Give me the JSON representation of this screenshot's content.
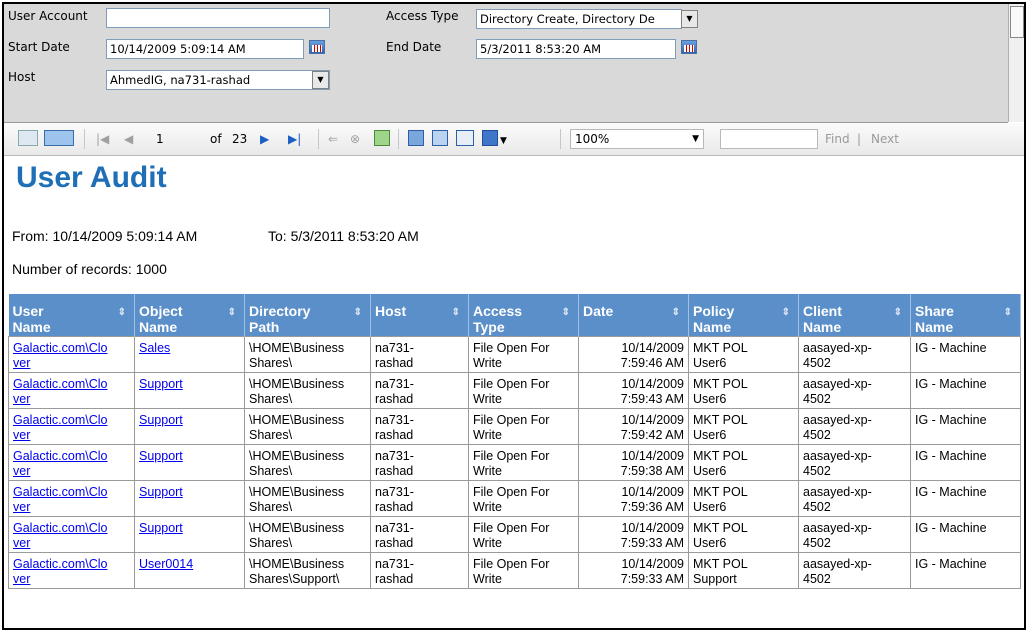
{
  "params": {
    "user_account_label": "User Account",
    "user_account_value": "",
    "access_type_label": "Access Type",
    "access_type_value": "Directory Create, Directory De",
    "start_date_label": "Start Date",
    "start_date_value": "10/14/2009 5:09:14 AM",
    "end_date_label": "End Date",
    "end_date_value": "5/3/2011 8:53:20 AM",
    "host_label": "Host",
    "host_value": "AhmedIG, na731-rashad"
  },
  "toolbar": {
    "page_current": "1",
    "page_of": "of",
    "page_total": "23",
    "zoom": "100%",
    "find_label": "Find",
    "find_sep": "|",
    "next_label": "Next"
  },
  "report": {
    "title": "User Audit",
    "from_text": "From: 10/14/2009 5:09:14 AM",
    "to_text": "To: 5/3/2011 8:53:20 AM",
    "records_text": "Number of records: 1000",
    "columns": [
      [
        "User",
        "Name"
      ],
      [
        "Object",
        "Name"
      ],
      [
        "Directory",
        "Path"
      ],
      [
        "Host",
        ""
      ],
      [
        "Access",
        "Type"
      ],
      [
        "Date",
        ""
      ],
      [
        "Policy",
        "Name"
      ],
      [
        "Client",
        "Name"
      ],
      [
        "Share",
        "Name"
      ]
    ],
    "sort_glyph": "⇕",
    "rows": [
      {
        "user": [
          "Galactic.com\\Clo",
          "ver"
        ],
        "object": "Sales",
        "path": [
          "\\HOME\\Business",
          "Shares\\"
        ],
        "host": [
          "na731-",
          "rashad"
        ],
        "access": [
          "File Open For",
          "Write"
        ],
        "date": [
          "10/14/2009",
          "7:59:46 AM"
        ],
        "policy": [
          "MKT POL",
          "User6"
        ],
        "client": [
          "aasayed-xp-",
          "4502"
        ],
        "share": "IG - Machine"
      },
      {
        "user": [
          "Galactic.com\\Clo",
          "ver"
        ],
        "object": "Support",
        "path": [
          "\\HOME\\Business",
          "Shares\\"
        ],
        "host": [
          "na731-",
          "rashad"
        ],
        "access": [
          "File Open For",
          "Write"
        ],
        "date": [
          "10/14/2009",
          "7:59:43 AM"
        ],
        "policy": [
          "MKT POL",
          "User6"
        ],
        "client": [
          "aasayed-xp-",
          "4502"
        ],
        "share": "IG - Machine"
      },
      {
        "user": [
          "Galactic.com\\Clo",
          "ver"
        ],
        "object": "Support",
        "path": [
          "\\HOME\\Business",
          "Shares\\"
        ],
        "host": [
          "na731-",
          "rashad"
        ],
        "access": [
          "File Open For",
          "Write"
        ],
        "date": [
          "10/14/2009",
          "7:59:42 AM"
        ],
        "policy": [
          "MKT POL",
          "User6"
        ],
        "client": [
          "aasayed-xp-",
          "4502"
        ],
        "share": "IG - Machine"
      },
      {
        "user": [
          "Galactic.com\\Clo",
          "ver"
        ],
        "object": "Support",
        "path": [
          "\\HOME\\Business",
          "Shares\\"
        ],
        "host": [
          "na731-",
          "rashad"
        ],
        "access": [
          "File Open For",
          "Write"
        ],
        "date": [
          "10/14/2009",
          "7:59:38 AM"
        ],
        "policy": [
          "MKT POL",
          "User6"
        ],
        "client": [
          "aasayed-xp-",
          "4502"
        ],
        "share": "IG - Machine"
      },
      {
        "user": [
          "Galactic.com\\Clo",
          "ver"
        ],
        "object": "Support",
        "path": [
          "\\HOME\\Business",
          "Shares\\"
        ],
        "host": [
          "na731-",
          "rashad"
        ],
        "access": [
          "File Open For",
          "Write"
        ],
        "date": [
          "10/14/2009",
          "7:59:36 AM"
        ],
        "policy": [
          "MKT POL",
          "User6"
        ],
        "client": [
          "aasayed-xp-",
          "4502"
        ],
        "share": "IG - Machine"
      },
      {
        "user": [
          "Galactic.com\\Clo",
          "ver"
        ],
        "object": "Support",
        "path": [
          "\\HOME\\Business",
          "Shares\\"
        ],
        "host": [
          "na731-",
          "rashad"
        ],
        "access": [
          "File Open For",
          "Write"
        ],
        "date": [
          "10/14/2009",
          "7:59:33 AM"
        ],
        "policy": [
          "MKT POL",
          "User6"
        ],
        "client": [
          "aasayed-xp-",
          "4502"
        ],
        "share": "IG - Machine"
      },
      {
        "user": [
          "Galactic.com\\Clo",
          "ver"
        ],
        "object": "User0014",
        "path": [
          "\\HOME\\Business",
          "Shares\\Support\\"
        ],
        "host": [
          "na731-",
          "rashad"
        ],
        "access": [
          "File Open For",
          "Write"
        ],
        "date": [
          "10/14/2009",
          "7:59:33 AM"
        ],
        "policy": [
          "MKT POL",
          "Support"
        ],
        "client": [
          "aasayed-xp-",
          "4502"
        ],
        "share": "IG - Machine"
      }
    ]
  }
}
